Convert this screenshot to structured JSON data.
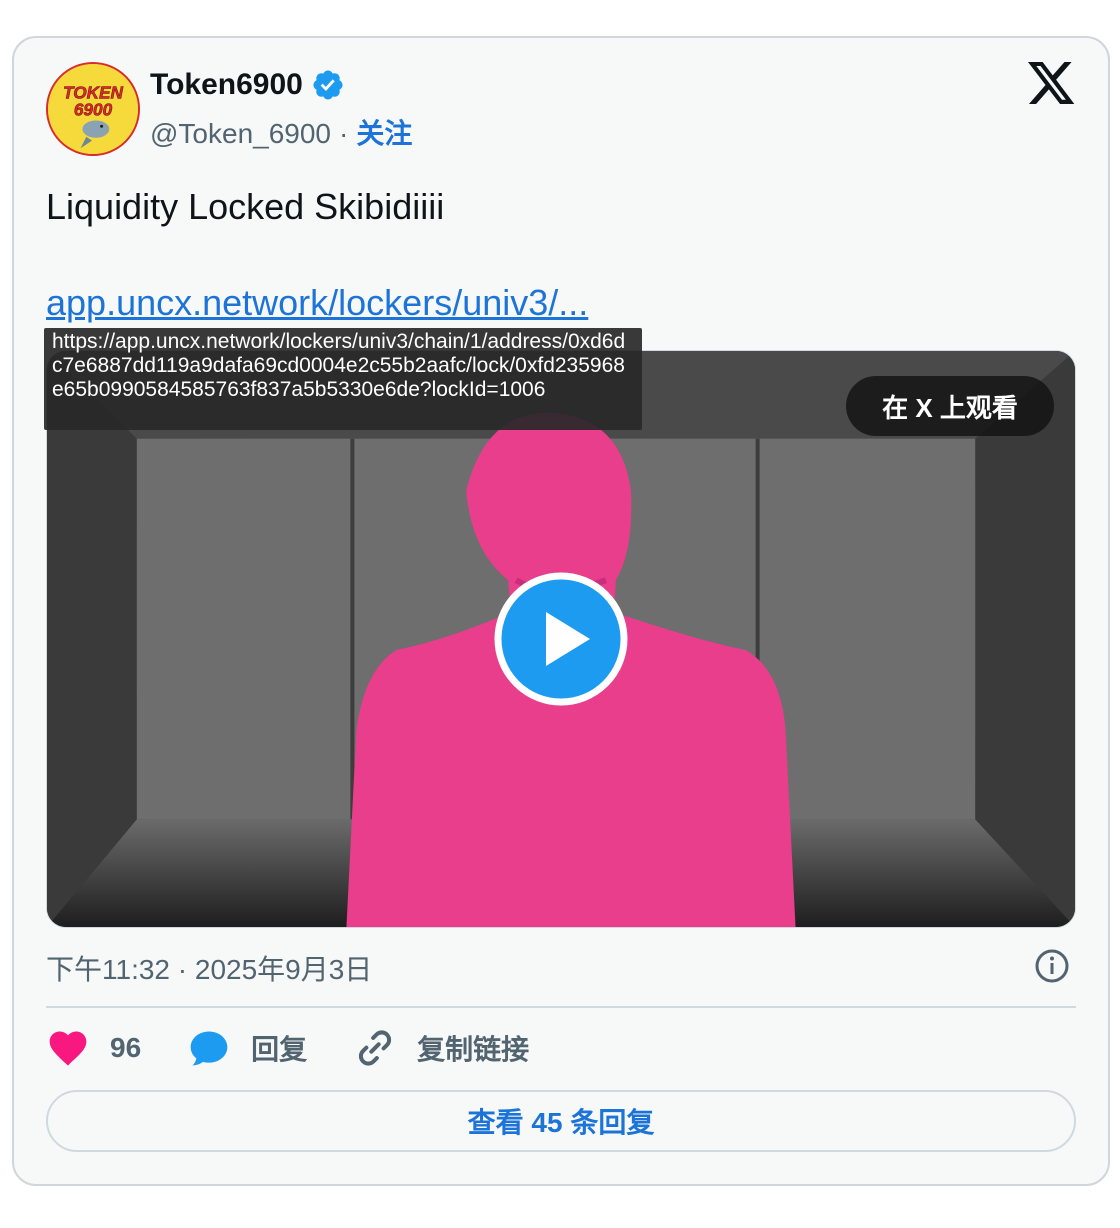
{
  "author": {
    "name": "Token6900",
    "handle": "@Token_6900",
    "separator": "·",
    "follow_label": "关注",
    "avatar_text_top": "TOKEN",
    "avatar_text_bottom": "6900"
  },
  "tweet": {
    "text": "Liquidity Locked Skibidiiii",
    "link_text": "app.uncx.network/lockers/univ3/...",
    "link_tooltip": "https://app.uncx.network/lockers/univ3/chain/1/address/0xd6dc7e6887dd119a9dafa69cd0004e2c55b2aafc/lock/0xfd235968e65b0990584585763f837a5b5330e6de?lockId=1006"
  },
  "media": {
    "watch_label": "在 X 上观看"
  },
  "meta": {
    "timestamp": "下午11:32 · 2025年9月3日"
  },
  "actions": {
    "likes_count": "96",
    "reply_label": "回复",
    "copy_link_label": "复制链接"
  },
  "view_replies_label": "查看 45 条回复",
  "colors": {
    "link": "#1d74d8",
    "like": "#f91880",
    "reply": "#1d9bf0",
    "verified": "#1d9bf0",
    "suit": "#e83e8c"
  }
}
